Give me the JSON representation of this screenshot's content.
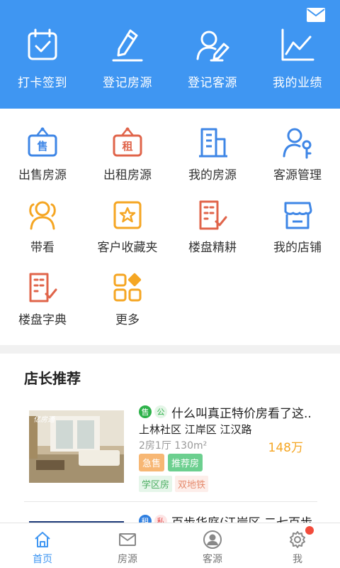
{
  "colors": {
    "primary": "#3f96f2",
    "blue_icon": "#3e86e6",
    "orange_icon": "#f5a623",
    "red_icon": "#e0644a",
    "price": "#f5a623"
  },
  "header": {
    "mail_icon": "envelope-icon",
    "actions": [
      {
        "label": "打卡签到",
        "icon": "calendar-check-icon"
      },
      {
        "label": "登记房源",
        "icon": "pen-icon"
      },
      {
        "label": "登记客源",
        "icon": "user-edit-icon"
      },
      {
        "label": "我的业绩",
        "icon": "line-chart-icon"
      }
    ]
  },
  "menu": {
    "items": [
      {
        "label": "出售房源",
        "icon": "sale-sign-icon",
        "sign": "售"
      },
      {
        "label": "出租房源",
        "icon": "rent-sign-icon",
        "sign": "租"
      },
      {
        "label": "我的房源",
        "icon": "buildings-icon"
      },
      {
        "label": "客源管理",
        "icon": "user-key-icon"
      },
      {
        "label": "带看",
        "icon": "users-icon"
      },
      {
        "label": "客户收藏夹",
        "icon": "star-folder-icon"
      },
      {
        "label": "楼盘精耕",
        "icon": "building-check-icon"
      },
      {
        "label": "我的店铺",
        "icon": "store-icon"
      },
      {
        "label": "楼盘字典",
        "icon": "building-list-icon"
      },
      {
        "label": "更多",
        "icon": "more-grid-icon"
      }
    ]
  },
  "recommend": {
    "title": "店长推荐",
    "listings": [
      {
        "image_watermark": "亿房通",
        "tag1": "售",
        "tag2": "公",
        "title": "什么叫真正特价房看了这..",
        "address": "上林社区 江岸区 江汉路",
        "spec": "2房1厅 130m²",
        "price": "148万",
        "badges": [
          "急售",
          "推荐房"
        ],
        "features": [
          "学区房",
          "双地铁"
        ]
      },
      {
        "tag1": "租",
        "tag2": "私",
        "title": "百步华庭(江岸区 二七百步"
      }
    ]
  },
  "bottom_nav": [
    {
      "label": "首页",
      "icon": "home-icon",
      "active": true
    },
    {
      "label": "房源",
      "icon": "mail-icon",
      "active": false
    },
    {
      "label": "客源",
      "icon": "person-icon",
      "active": false
    },
    {
      "label": "我",
      "icon": "gear-icon",
      "active": false
    }
  ]
}
